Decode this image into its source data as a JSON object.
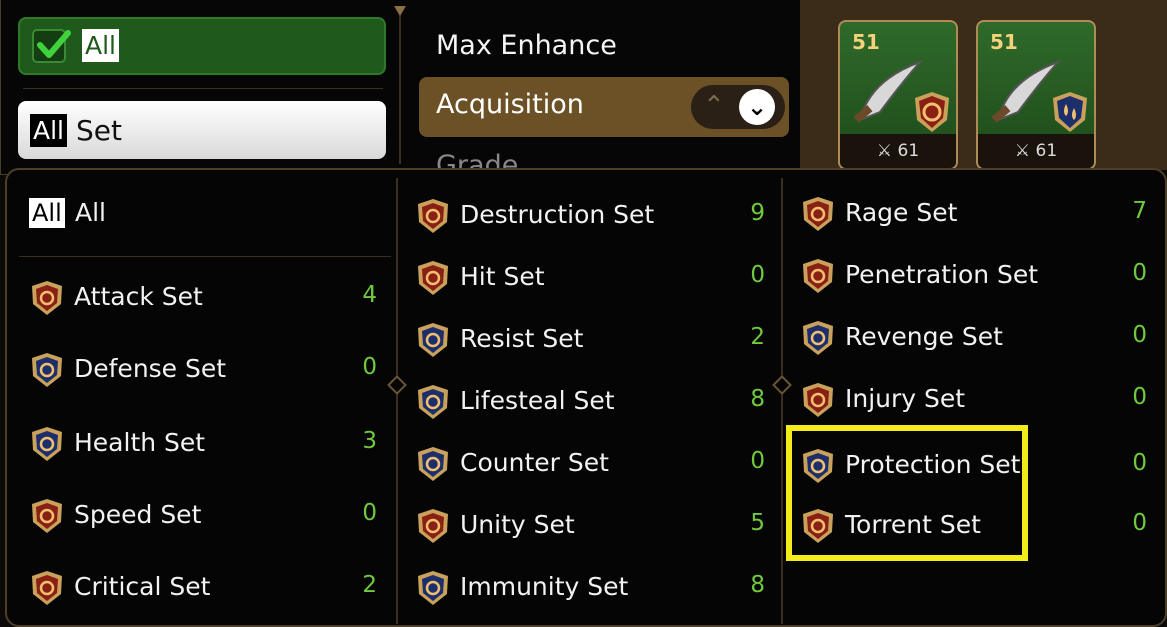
{
  "filters": {
    "all_toggle_label": "All",
    "all_badge": "All",
    "set_select_label": "Set"
  },
  "sort": {
    "options": [
      "Max Enhance",
      "Acquisition",
      "Grade"
    ],
    "active": "Acquisition"
  },
  "equipment_cards": [
    {
      "level": "51",
      "stat": "61",
      "set": "destruction"
    },
    {
      "level": "51",
      "stat": "61",
      "set": "lifesteal"
    }
  ],
  "set_filter": {
    "all_badge": "All",
    "all_label": "All",
    "columns": [
      [
        {
          "name": "Attack Set",
          "count": "4",
          "icon": "attack-set-icon"
        },
        {
          "name": "Defense Set",
          "count": "0",
          "icon": "defense-set-icon"
        },
        {
          "name": "Health Set",
          "count": "3",
          "icon": "health-set-icon"
        },
        {
          "name": "Speed Set",
          "count": "0",
          "icon": "speed-set-icon"
        },
        {
          "name": "Critical Set",
          "count": "2",
          "icon": "critical-set-icon"
        }
      ],
      [
        {
          "name": "Destruction Set",
          "count": "9",
          "icon": "destruction-set-icon"
        },
        {
          "name": "Hit Set",
          "count": "0",
          "icon": "hit-set-icon"
        },
        {
          "name": "Resist Set",
          "count": "2",
          "icon": "resist-set-icon"
        },
        {
          "name": "Lifesteal Set",
          "count": "8",
          "icon": "lifesteal-set-icon"
        },
        {
          "name": "Counter Set",
          "count": "0",
          "icon": "counter-set-icon"
        },
        {
          "name": "Unity Set",
          "count": "5",
          "icon": "unity-set-icon"
        },
        {
          "name": "Immunity Set",
          "count": "8",
          "icon": "immunity-set-icon"
        }
      ],
      [
        {
          "name": "Rage Set",
          "count": "7",
          "icon": "rage-set-icon"
        },
        {
          "name": "Penetration Set",
          "count": "0",
          "icon": "penetration-set-icon"
        },
        {
          "name": "Revenge Set",
          "count": "0",
          "icon": "revenge-set-icon"
        },
        {
          "name": "Injury Set",
          "count": "0",
          "icon": "injury-set-icon"
        },
        {
          "name": "Protection Set",
          "count": "0",
          "icon": "protection-set-icon"
        },
        {
          "name": "Torrent Set",
          "count": "0",
          "icon": "torrent-set-icon"
        }
      ]
    ]
  },
  "colors": {
    "count_green": "#6fca3d",
    "highlight_yellow": "#f3ec1a",
    "active_sort_bg": "#6b5125",
    "all_toggle_green": "#1f5a1c"
  }
}
